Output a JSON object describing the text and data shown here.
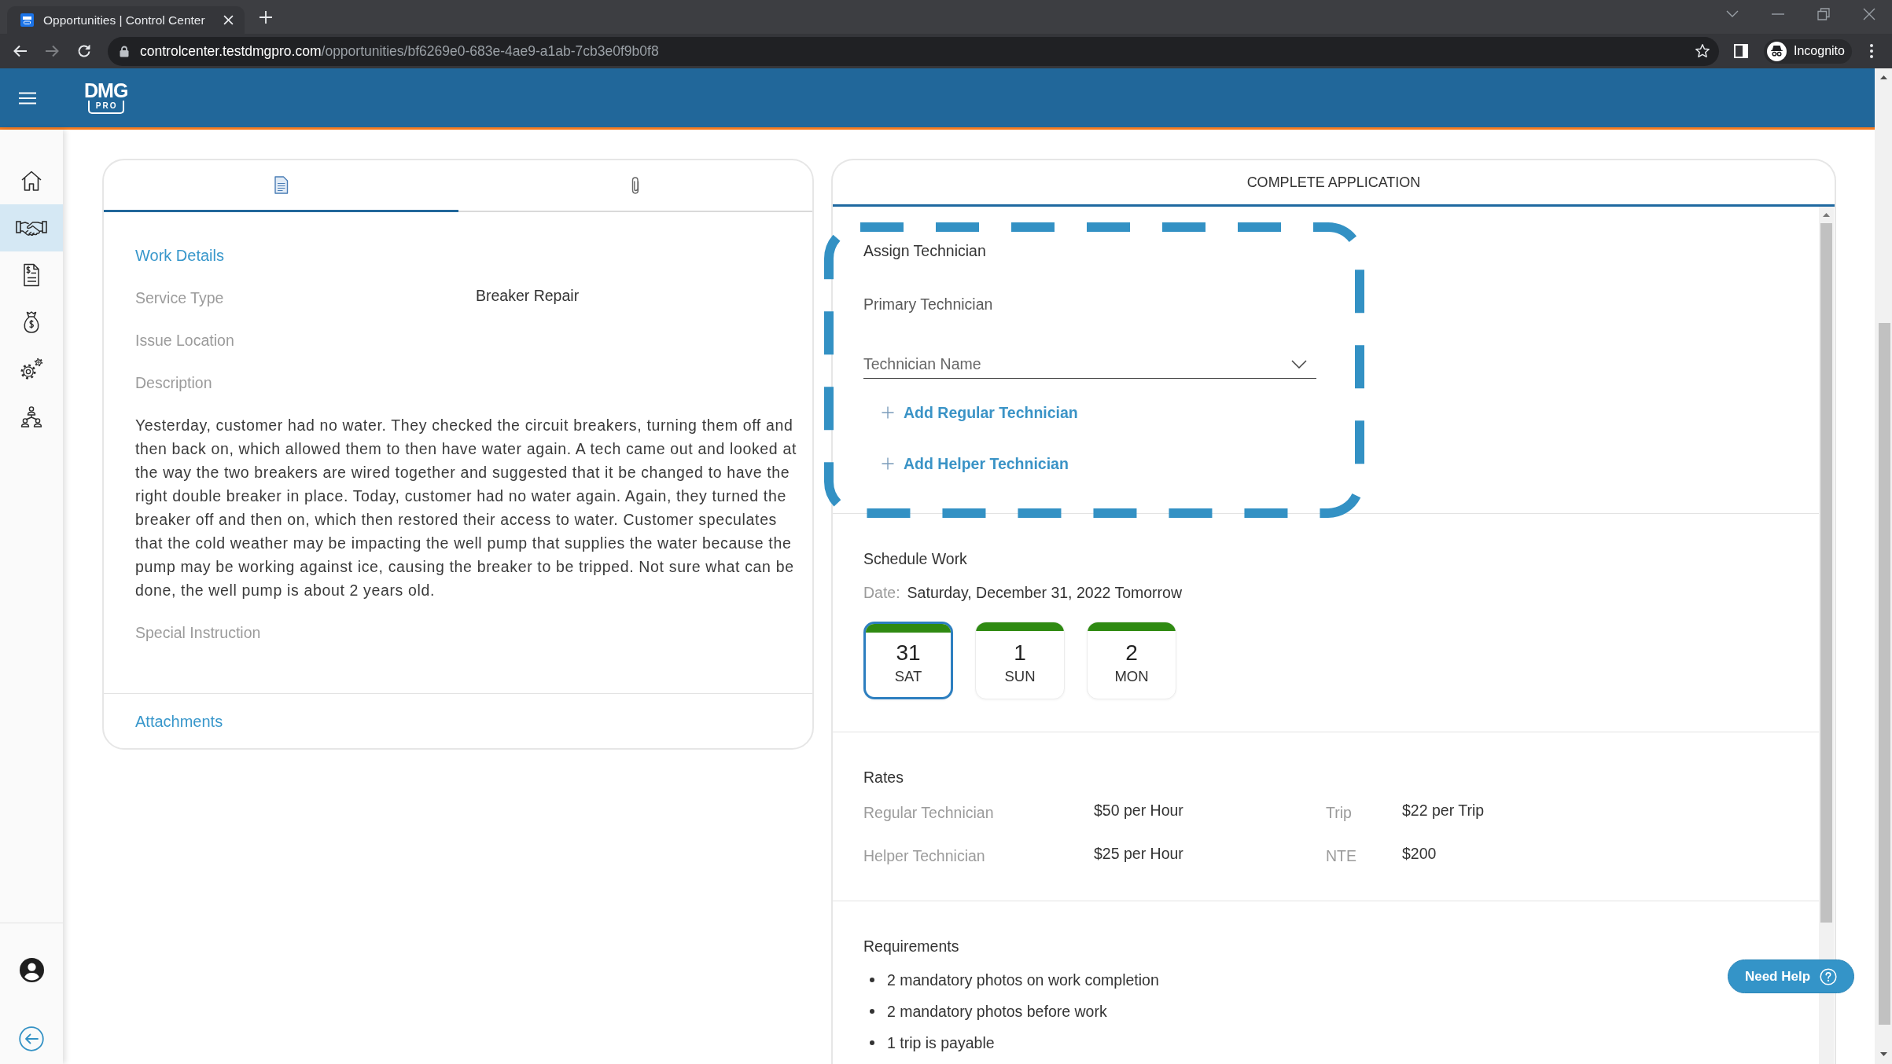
{
  "browser": {
    "tab": {
      "title": "Opportunities | Control Center"
    },
    "history": {
      "back_disabled": false,
      "forward_disabled": true
    },
    "address_bar": {
      "host": "controlcenter.testdmgpro.com",
      "path": "/opportunities/bf6269e0-683e-4ae9-a1ab-7cb3e0f9b0f8"
    },
    "profile": {
      "label": "Incognito"
    }
  },
  "header": {
    "logo": {
      "wordmark": "DMG",
      "tag": "PRO"
    }
  },
  "sidebar": {
    "items": [
      {
        "selected": false
      },
      {
        "selected": true
      },
      {
        "selected": false
      },
      {
        "selected": false
      },
      {
        "selected": false
      },
      {
        "selected": false
      }
    ]
  },
  "work_panel": {
    "tabs": [
      {
        "selected": true
      },
      {
        "selected": false
      }
    ],
    "heading": "Work Details",
    "fields": [
      {
        "label": "Service Type",
        "value": "Breaker Repair"
      },
      {
        "label": "Issue Location"
      },
      {
        "label": "Description",
        "text": "Yesterday, customer had no water. They checked the circuit breakers, turning them off and then back on, which allowed them to then have water again. A tech came out and looked at the way the two breakers are wired together and suggested that it be changed to have the right double breaker in place. Today, customer had no water again. Again, they turned the breaker off and then on, which then restored their access to water. Customer speculates that the cold weather may be impacting the well pump that supplies the water because the pump may be working against ice, causing the breaker to be tripped. Not sure what can be done, the well pump is about 2 years old."
      },
      {
        "label": "Special Instruction"
      }
    ],
    "attachments_heading": "Attachments"
  },
  "application_panel": {
    "title": "COMPLETE APPLICATION",
    "assign": {
      "heading": "Assign Technician",
      "primary_label": "Primary Technician",
      "select": {
        "placeholder": "Technician Name"
      },
      "add_links": [
        "Add Regular Technician",
        "Add Helper Technician"
      ]
    },
    "schedule": {
      "heading": "Schedule Work",
      "date_label": "Date:",
      "date_value": "Saturday, December 31, 2022 Tomorrow",
      "days": [
        {
          "day": "31",
          "weekday": "SAT",
          "selected": true
        },
        {
          "day": "1",
          "weekday": "SUN",
          "selected": false
        },
        {
          "day": "2",
          "weekday": "MON",
          "selected": false
        }
      ]
    },
    "rates": {
      "heading": "Rates",
      "rows": [
        {
          "label": "Regular Technician",
          "value": "$50 per Hour",
          "extra_label": "Trip",
          "extra_value": "$22 per Trip"
        },
        {
          "label": "Helper Technician",
          "value": "$25 per Hour",
          "extra_label": "NTE",
          "extra_value": "$200"
        }
      ]
    },
    "requirements": {
      "heading": "Requirements",
      "items": [
        "2 mandatory photos on work completion",
        "2 mandatory photos before work",
        "1 trip is payable"
      ]
    }
  },
  "help_button": {
    "label": "Need Help"
  }
}
